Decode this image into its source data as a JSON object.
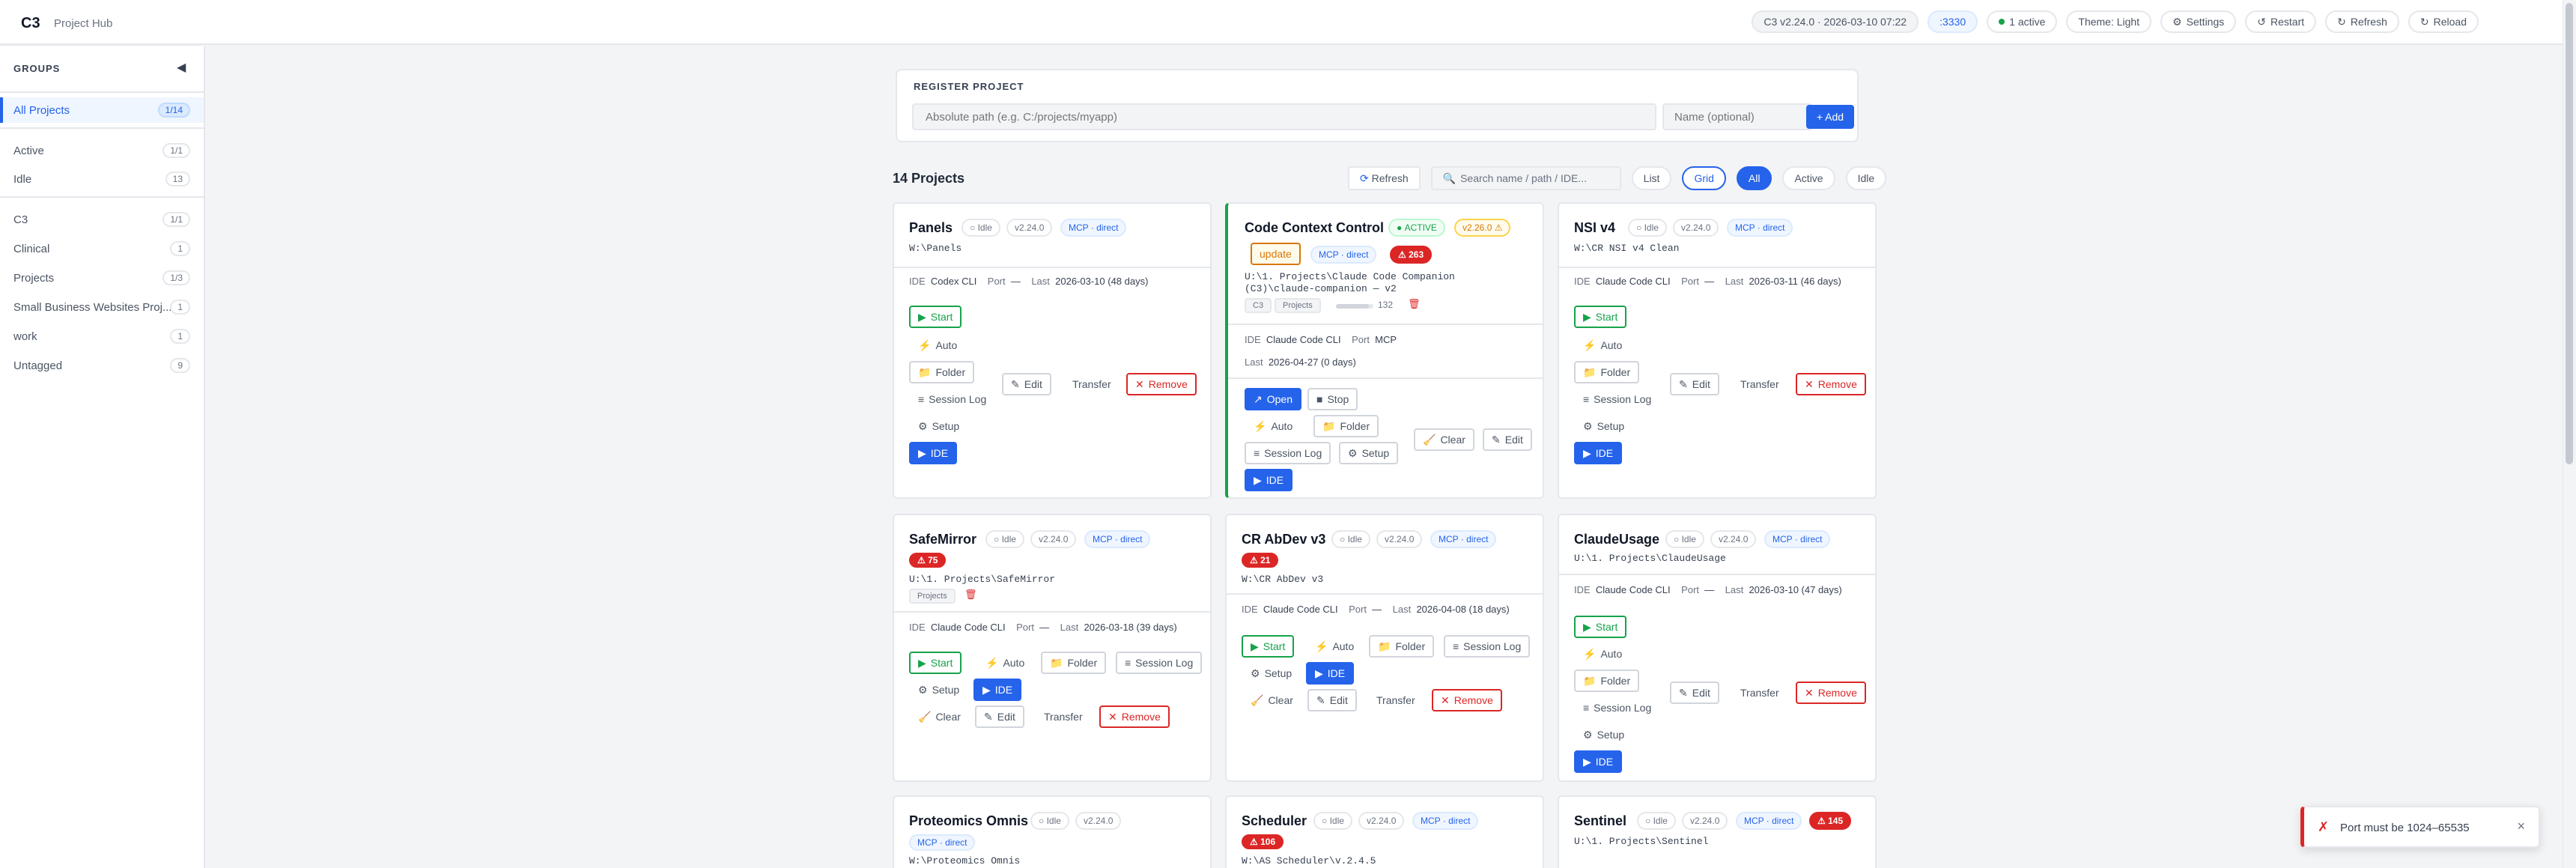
{
  "header": {
    "logo": "C3",
    "subtitle": "Project Hub",
    "version": "C3 v2.24.0 · 2026-03-10 07:22",
    "port": ":3330",
    "active": "1 active",
    "theme": "Theme: Light",
    "settings": "Settings",
    "restart": "Restart",
    "refresh": "Refresh",
    "reload": "Reload"
  },
  "sidebar": {
    "title": "GROUPS",
    "collapse": "◀",
    "items": [
      {
        "label": "All Projects",
        "count": "1/14"
      },
      {
        "label": "Active",
        "count": "1/1"
      },
      {
        "label": "Idle",
        "count": "13"
      },
      {
        "label": "C3",
        "count": "1/1"
      },
      {
        "label": "Clinical",
        "count": "1"
      },
      {
        "label": "Projects",
        "count": "1/3"
      },
      {
        "label": "Small Business Websites Proj...",
        "count": "1"
      },
      {
        "label": "work",
        "count": "1"
      },
      {
        "label": "Untagged",
        "count": "9"
      }
    ]
  },
  "register": {
    "title": "REGISTER PROJECT",
    "path_placeholder": "Absolute path (e.g. C:/projects/myapp)",
    "name_placeholder": "Name (optional)",
    "add": "+ Add"
  },
  "toolbar": {
    "count": "14 Projects",
    "refresh": "Refresh",
    "search_placeholder": "Search name / path / IDE...",
    "list": "List",
    "grid": "Grid",
    "all": "All",
    "active": "Active",
    "idle": "Idle"
  },
  "labels": {
    "idle": "Idle",
    "active": "ACTIVE",
    "version": "v2.24.0",
    "mcp": "MCP · direct",
    "mcp_short": "MCP",
    "ide": "IDE",
    "port": "Port",
    "last": "Last",
    "dash": "—",
    "start": "Start",
    "auto": "Auto",
    "folder": "Folder",
    "session_log": "Session Log",
    "setup": "Setup",
    "ide_btn": "IDE",
    "edit": "Edit",
    "transfer": "Transfer",
    "remove": "Remove",
    "clear": "Clear",
    "open": "Open",
    "stop": "Stop",
    "update": "update",
    "projects_tag": "Projects",
    "c3_tag": "C3"
  },
  "cards": {
    "panels": {
      "name": "Panels",
      "path": "W:\\Panels",
      "ide": "Codex CLI",
      "last": "2026-03-10 (48 days)"
    },
    "ccc": {
      "name": "Code Context Control",
      "version": "v2.26.0 ⚠",
      "alerts": "263",
      "path1": "U:\\1. Projects\\Claude Code Companion",
      "path2": "(C3)\\claude-companion — v2",
      "progress": "132",
      "ide": "Claude Code CLI",
      "last": "2026-04-27 (0 days)"
    },
    "nsi": {
      "name": "NSI v4",
      "path": "W:\\CR NSI v4 Clean",
      "ide": "Claude Code CLI",
      "last": "2026-03-11 (46 days)"
    },
    "safemirror": {
      "name": "SafeMirror",
      "alerts": "75",
      "path": "U:\\1. Projects\\SafeMirror",
      "ide": "Claude Code CLI",
      "last": "2026-03-18 (39 days)"
    },
    "abdev": {
      "name": "CR AbDev v3",
      "alerts": "21",
      "path": "W:\\CR AbDev v3",
      "ide": "Claude Code CLI",
      "last": "2026-04-08 (18 days)"
    },
    "claudeusage": {
      "name": "ClaudeUsage",
      "path": "U:\\1. Projects\\ClaudeUsage",
      "ide": "Claude Code CLI",
      "last": "2026-03-10 (47 days)"
    },
    "proteomics": {
      "name": "Proteomics Omnis",
      "path": "W:\\Proteomics Omnis"
    },
    "scheduler": {
      "name": "Scheduler",
      "alerts": "106",
      "path": "W:\\AS Scheduler\\v.2.4.5"
    },
    "sentinel": {
      "name": "Sentinel",
      "alerts": "145",
      "path": "U:\\1. Projects\\Sentinel"
    }
  },
  "toast": {
    "icon": "✗",
    "message": "Port must be 1024–65535",
    "close": "×"
  },
  "colors": {
    "accent": "#2563eb",
    "active": "#16a34a",
    "danger": "#dc2626",
    "warning": "#d97706"
  }
}
